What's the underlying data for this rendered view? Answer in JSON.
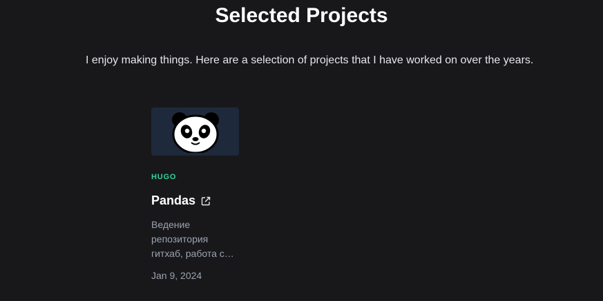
{
  "section": {
    "title": "Selected Projects",
    "intro": "I enjoy making things. Here are a selection of projects that I have worked on over the years."
  },
  "projects": [
    {
      "image_icon": "panda-icon",
      "tag": "HUGO",
      "name": "Pandas",
      "link_icon": "external-link-icon",
      "description": "Ведение репозитория гитхаб, работа с документацией",
      "date": "Jan 9, 2024"
    }
  ],
  "colors": {
    "background": "#18181b",
    "tag": "#34d399",
    "thumb_bg": "#1e293b"
  }
}
